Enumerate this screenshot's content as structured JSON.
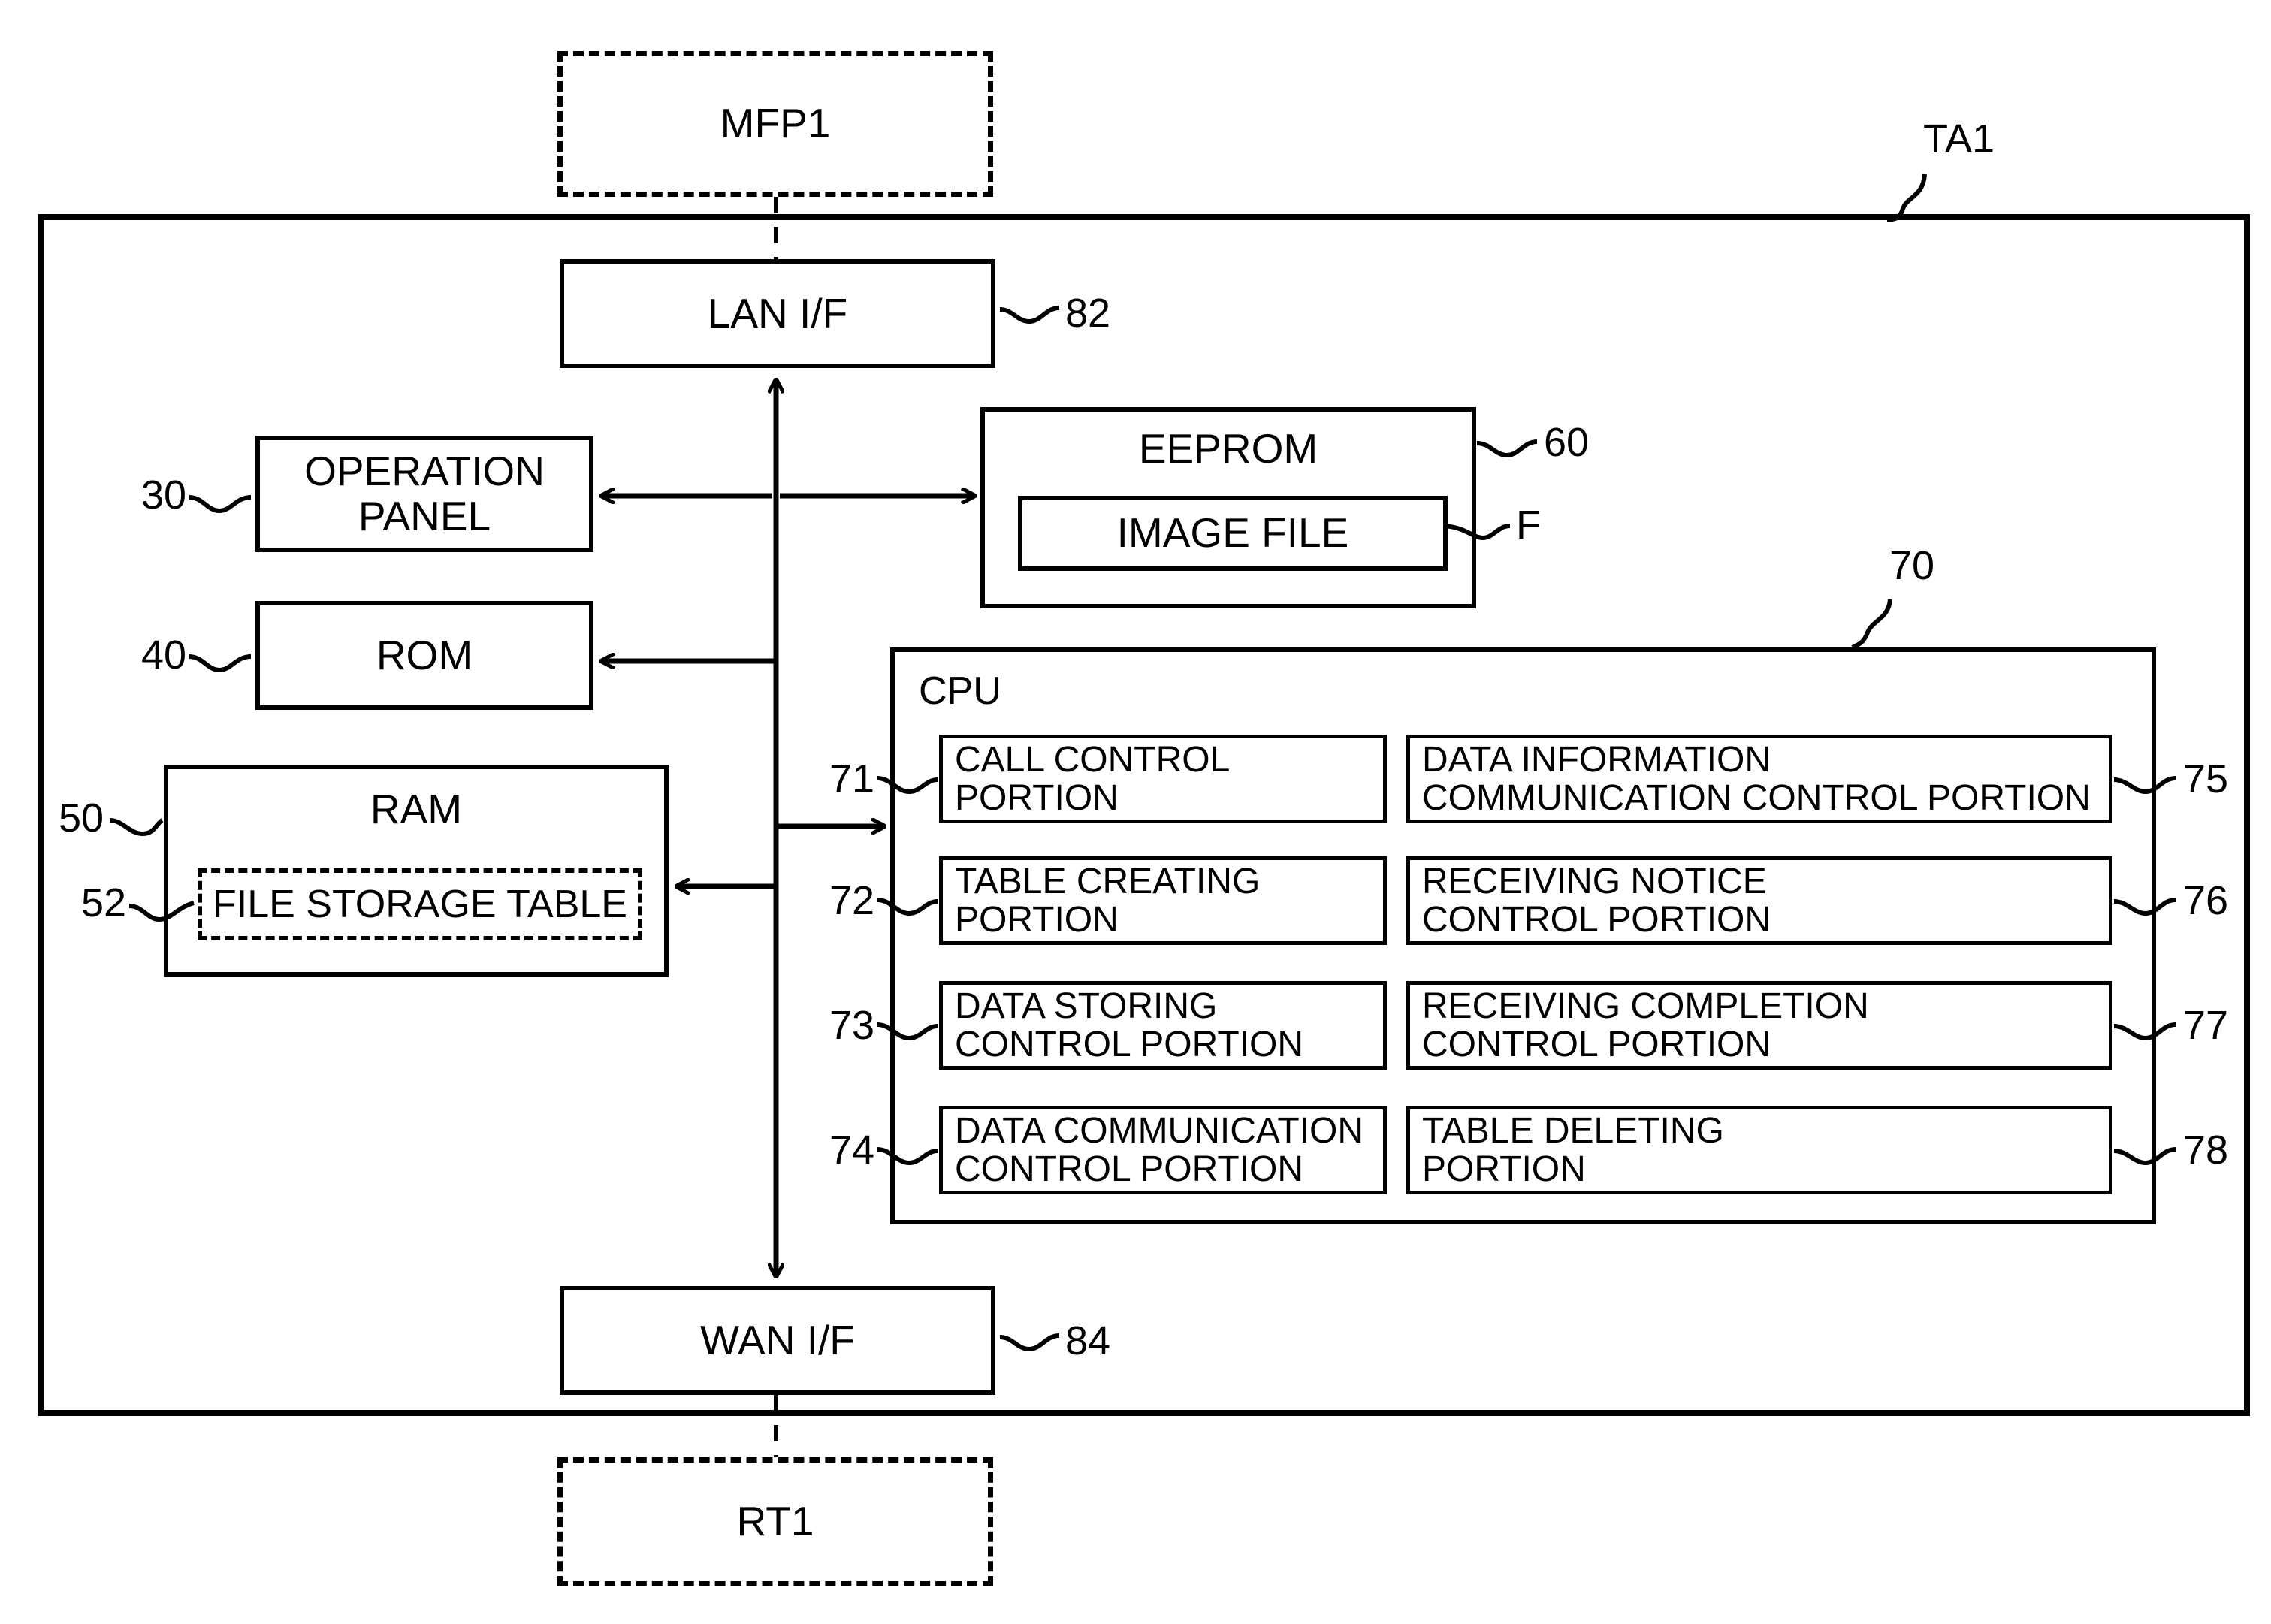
{
  "figure": {
    "external_nodes": [
      {
        "id": "mfp1",
        "label": "MFP1"
      },
      {
        "id": "rt1",
        "label": "RT1"
      }
    ],
    "device": {
      "ref": "TA1",
      "interfaces": [
        {
          "id": "lan",
          "label": "LAN I/F",
          "ref": "82"
        },
        {
          "id": "wan",
          "label": "WAN I/F",
          "ref": "84"
        }
      ],
      "components": [
        {
          "id": "operation_panel",
          "label": "OPERATION\nPANEL",
          "ref": "30"
        },
        {
          "id": "rom",
          "label": "ROM",
          "ref": "40"
        },
        {
          "id": "ram",
          "label": "RAM",
          "ref": "50"
        },
        {
          "id": "file_storage_table",
          "label": "FILE STORAGE TABLE",
          "ref": "52"
        },
        {
          "id": "eeprom",
          "label": "EEPROM",
          "ref": "60"
        },
        {
          "id": "image_file",
          "label": "IMAGE FILE",
          "ref": "F"
        }
      ],
      "cpu": {
        "label": "CPU",
        "ref": "70",
        "portions_left": [
          {
            "ref": "71",
            "label": "CALL CONTROL\nPORTION"
          },
          {
            "ref": "72",
            "label": "TABLE CREATING\nPORTION"
          },
          {
            "ref": "73",
            "label": "DATA STORING\nCONTROL PORTION"
          },
          {
            "ref": "74",
            "label": "DATA COMMUNICATION\nCONTROL PORTION"
          }
        ],
        "portions_right": [
          {
            "ref": "75",
            "label": "DATA INFORMATION\nCOMMUNICATION CONTROL PORTION"
          },
          {
            "ref": "76",
            "label": "RECEIVING NOTICE\nCONTROL PORTION"
          },
          {
            "ref": "77",
            "label": "RECEIVING COMPLETION\nCONTROL PORTION"
          },
          {
            "ref": "78",
            "label": "TABLE DELETING\nPORTION"
          }
        ]
      }
    },
    "colors": {
      "stroke": "#000000",
      "background": "#ffffff"
    }
  }
}
